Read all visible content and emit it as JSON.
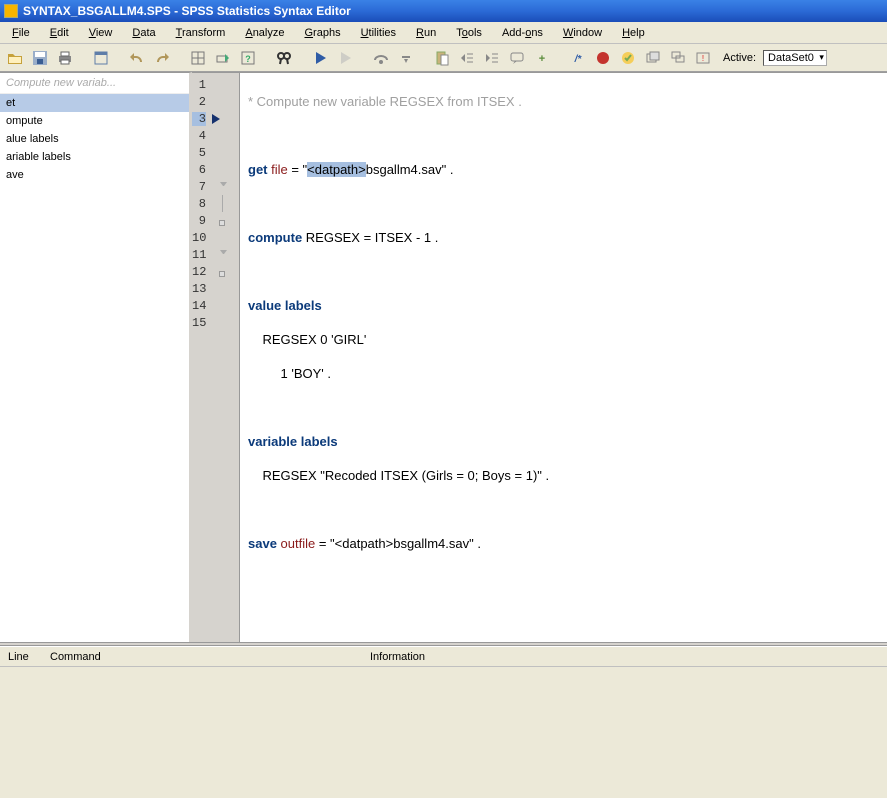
{
  "window": {
    "title": "SYNTAX_BSGALLM4.SPS - SPSS Statistics Syntax Editor"
  },
  "menu": {
    "file": "File",
    "edit": "Edit",
    "view": "View",
    "data": "Data",
    "transform": "Transform",
    "analyze": "Analyze",
    "graphs": "Graphs",
    "utilities": "Utilities",
    "run": "Run",
    "tools": "Tools",
    "addons": "Add-ons",
    "window": "Window",
    "help": "Help"
  },
  "toolbar": {
    "active_label": "Active:",
    "dataset": "DataSet0"
  },
  "nav": {
    "header": "Compute new variab...",
    "items": [
      "et",
      "ompute",
      "alue labels",
      "ariable labels",
      "ave"
    ]
  },
  "code": {
    "l1": "* Compute new variable REGSEX from ITSEX .",
    "l2": "",
    "l3_cmd": "get",
    "l3_sub": " file",
    "l3_eq": " = \"",
    "l3_mark": "<datpath>",
    "l3_rest": "bsgallm4.sav\" .",
    "l4": "",
    "l5_cmd": "compute",
    "l5_rest": " REGSEX = ITSEX - 1 .",
    "l6": "",
    "l7_cmd": "value labels",
    "l8": "    REGSEX 0 'GIRL'",
    "l9": "         1 'BOY' .",
    "l10": "",
    "l11_cmd": "variable labels",
    "l12": "    REGSEX \"Recoded ITSEX (Girls = 0; Boys = 1)\" .",
    "l13": "",
    "l14_cmd": "save",
    "l14_sub": " outfile",
    "l14_rest": " = \"<datpath>bsgallm4.sav\" .",
    "l15": ""
  },
  "gutter": {
    "n1": "1",
    "n2": "2",
    "n3": "3",
    "n4": "4",
    "n5": "5",
    "n6": "6",
    "n7": "7",
    "n8": "8",
    "n9": "9",
    "n10": "10",
    "n11": "11",
    "n12": "12",
    "n13": "13",
    "n14": "14",
    "n15": "15"
  },
  "output": {
    "col_line": "Line",
    "col_command": "Command",
    "col_info": "Information"
  }
}
